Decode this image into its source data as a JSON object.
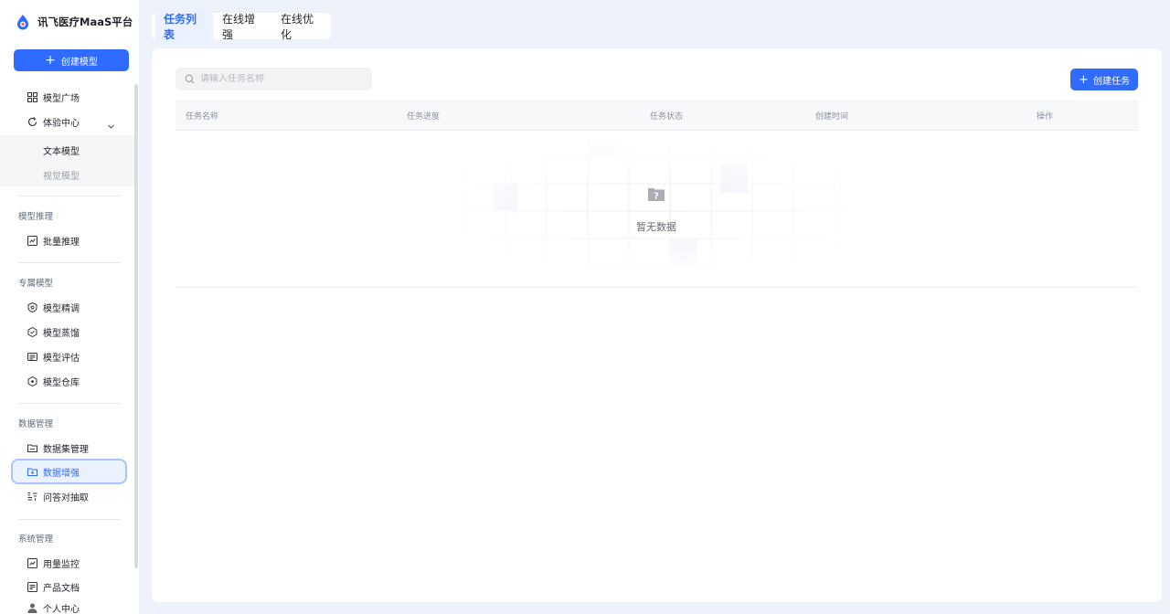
{
  "brand": {
    "title": "讯飞医疗MaaS平台"
  },
  "sidebar": {
    "create_model_label": "创建模型",
    "items": {
      "model_square": "模型广场",
      "experience_center": "体验中心",
      "text_model": "文本模型",
      "vision_model": "视觉模型",
      "batch_inference": "批量推理",
      "fine_tune": "模型精调",
      "distill": "模型蒸馏",
      "evaluate": "模型评估",
      "warehouse": "模型仓库",
      "dataset_manage": "数据集管理",
      "data_augment": "数据增强",
      "qa_extract": "问答对抽取",
      "usage_monitor": "用量监控",
      "product_docs": "产品文档",
      "personal_center": "个人中心"
    },
    "sections": {
      "inference": "模型推理",
      "exclusive": "专属模型",
      "data": "数据管理",
      "system": "系统管理"
    }
  },
  "tabs": [
    {
      "label": "任务列表",
      "active": true
    },
    {
      "label": "在线增强",
      "active": false
    },
    {
      "label": "在线优化",
      "active": false
    }
  ],
  "main": {
    "search_placeholder": "请输入任务名称",
    "create_task_label": "创建任务",
    "columns": [
      "任务名称",
      "任务进度",
      "任务状态",
      "创建时间",
      "操作"
    ],
    "empty_text": "暂无数据"
  },
  "colors": {
    "primary": "#2f6bff",
    "active_bg": "#eaf1ff",
    "page_bg": "#eef2fa"
  }
}
